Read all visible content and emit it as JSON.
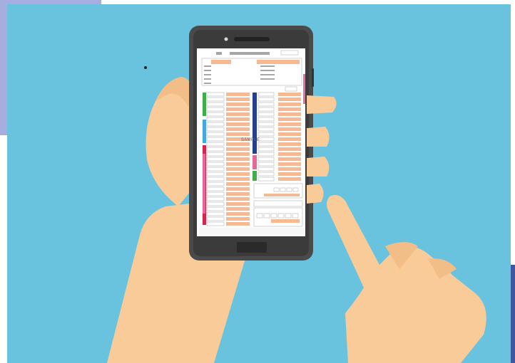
{
  "illustration": {
    "colors": {
      "sky": "#69c3df",
      "corner_lavender": "#a5aede",
      "corner_navy": "#3f579e",
      "skin": "#f9cb98",
      "skin_shadow": "#e9ab73",
      "phone_body": "#4a4a4a",
      "phone_bezel": "#3b3b3b",
      "form_peach": "#f5b994",
      "form_grey": "#a6a6a6",
      "bar_green": "#3fae4a",
      "bar_blue": "#46a8e0",
      "bar_red": "#d5264d",
      "bar_pink": "#e8679a",
      "bar_navy": "#253f8f",
      "bar_magenta": "#e26fa7"
    },
    "icons": [
      "hand-holding-phone-icon",
      "pointing-finger-icon",
      "smartphone-icon"
    ],
    "sample_stamp": "SAMPLE"
  }
}
